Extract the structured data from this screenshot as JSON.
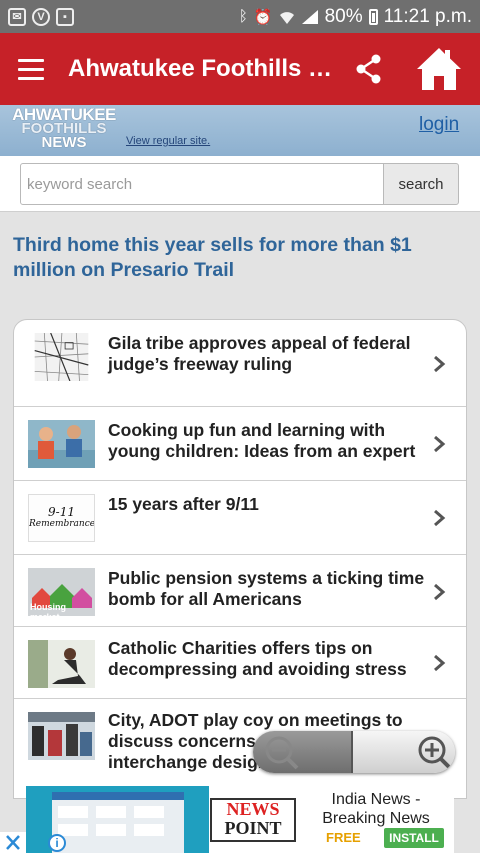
{
  "status_bar": {
    "battery_percent": "80%",
    "time": "11:21 p.m.",
    "left_icons": [
      "notification-icon",
      "vpn-icon",
      "clipboard-icon"
    ],
    "right_icons": [
      "bluetooth-icon",
      "alarm-icon",
      "wifi-icon",
      "signal-icon",
      "battery-icon"
    ]
  },
  "app_bar": {
    "title": "Ahwatukee Foothills News",
    "color": "#c62128"
  },
  "brand": {
    "logo_line1": "AHWATUKEE",
    "logo_line2": "FOOTHILLS",
    "logo_line3": "NEWS",
    "view_regular": "View regular site.",
    "login": "login"
  },
  "search": {
    "placeholder": "keyword search",
    "value": "",
    "button": "search"
  },
  "headline": "Third home this year sells for more than $1 million on Presario Trail",
  "stories": [
    {
      "title": "Gila tribe approves appeal of federal judge’s freeway ruling",
      "thumb": "map"
    },
    {
      "title": "Cooking up fun and learning with young children: Ideas from an expert",
      "thumb": "kids"
    },
    {
      "title": "15 years after 9/11",
      "thumb": "sign",
      "thumb_text1": "9-11",
      "thumb_text2": "Remembrance"
    },
    {
      "title": "Public pension systems a ticking time bomb for all Americans",
      "thumb": "housing",
      "thumb_text": "Housing market"
    },
    {
      "title": "Catholic Charities offers tips on decompressing and avoiding stress",
      "thumb": "sitting"
    },
    {
      "title": "City, ADOT play coy on meetings to discuss concerns over freeway interchange design change",
      "thumb": "crowd"
    }
  ],
  "ad": {
    "badge_line1": "NEWS",
    "badge_line2": "POINT",
    "title": "India News - Breaking News",
    "free": "FREE",
    "install": "INSTALL",
    "info": "i"
  }
}
